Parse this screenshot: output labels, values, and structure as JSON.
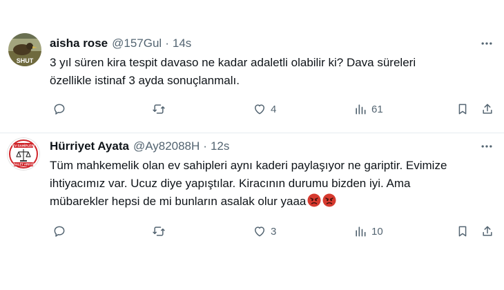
{
  "tweets": [
    {
      "name": "aisha rose",
      "handle": "@157Gul",
      "separator": "·",
      "time": "14s",
      "avatar_text": "SHUT",
      "lines": [
        "3 yıl süren kira tespit davaso ne kadar adaletli olabilir ki?  Dava süreleri",
        "özellikle istinaf 3 ayda sonuçlanmalı."
      ],
      "replies": "",
      "retweets": "",
      "likes": "4",
      "views": "61"
    },
    {
      "name": "Hürriyet Ayata",
      "handle": "@Ay82088H",
      "separator": "·",
      "time": "12s",
      "avatar_text_top": "EV SAHİPLERİ",
      "avatar_text_bottom": "ADALET ARIYOR",
      "lines": [
        "Tüm mahkemelik olan ev sahipleri aynı kaderi paylaşıyor ne gariptir. Evimize",
        "ihtiyacımız var. Ucuz diye yapıştılar.  Kiracının durumu bizden iyi. Ama",
        "mübarekler hepsi de mi bunların  asalak olur yaaa"
      ],
      "emojis": [
        "angry-face-icon",
        "angry-face-icon"
      ],
      "replies": "",
      "retweets": "",
      "likes": "3",
      "views": "10"
    }
  ],
  "colors": {
    "text": "#0f1419",
    "secondary": "#536471",
    "divider": "#e6ecf0",
    "emoji": "#d63a2f",
    "logo_red": "#d0262b"
  }
}
